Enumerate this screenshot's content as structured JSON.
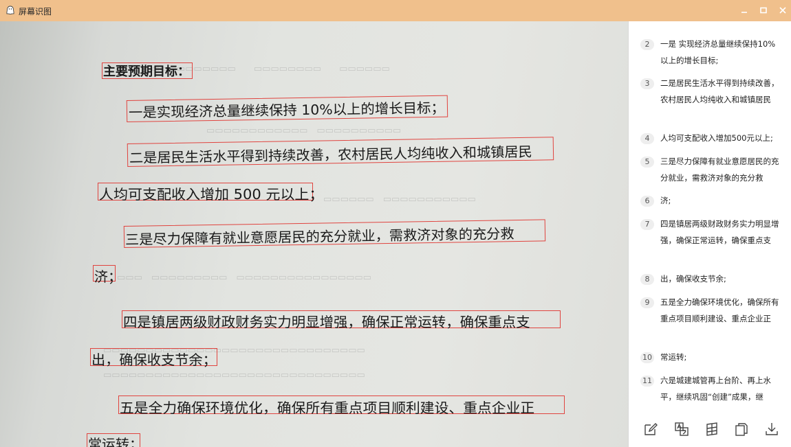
{
  "window": {
    "title": "屏幕识图"
  },
  "preview": {
    "lines": [
      "主要预期目标：",
      "一是实现经济总量继续保持 10%以上的增长目标；",
      "二是居民生活水平得到持续改善，农村居民人均纯收入和城镇居民",
      "人均可支配收入增加 500 元以上；",
      "三是尽力保障有就业意愿居民的充分就业，需救济对象的充分救",
      "济；",
      "四是镇居两级财政财务实力明显增强，确保正常运转，确保重点支",
      "出，确保收支节余；",
      "五是全力确保环境优化，确保所有重点项目顺利建设、重点企业正",
      "常运转；"
    ]
  },
  "results": [
    {
      "num": "2",
      "text": "一是 实现经济总量继续保持10%以上的增长目标;"
    },
    {
      "num": "3",
      "text": "二是居民生活水平得到持续改善，农村居民人均纯收入和城镇居民"
    },
    {
      "num": "4",
      "text": "人均可支配收入增加500元以上;"
    },
    {
      "num": "5",
      "text": "三是尽力保障有就业意愿居民的充分就业，需救济对象的充分救"
    },
    {
      "num": "6",
      "text": "济;"
    },
    {
      "num": "7",
      "text": "四是镇居两级财政财务实力明显增强，确保正常运转，确保重点支"
    },
    {
      "num": "8",
      "text": "出，确保收支节余;"
    },
    {
      "num": "9",
      "text": "五是全力确保环境优化，确保所有重点项目顺利建设、重点企业正"
    },
    {
      "num": "10",
      "text": "常运转;"
    },
    {
      "num": "11",
      "text": "六是城建城管再上台阶、再上水平，继续巩固“创建”成果，继"
    }
  ],
  "colors": {
    "titlebar": "#f0c08c",
    "highlight": "#e0433e"
  },
  "icons": [
    "app-icon",
    "minimize-icon",
    "maximize-icon",
    "close-icon",
    "edit-icon",
    "translate-icon",
    "table-icon",
    "copy-icon",
    "download-icon"
  ]
}
